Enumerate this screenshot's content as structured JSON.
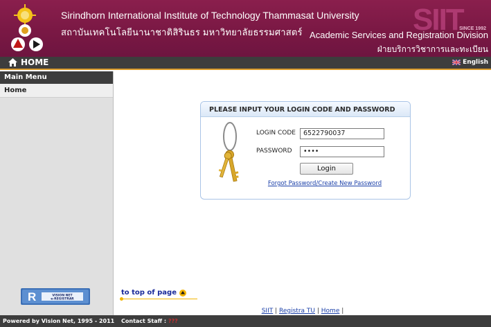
{
  "header": {
    "institute_en": "Sirindhorn International Institute of Technology Thammasat University",
    "institute_th": "สถาบันเทคโนโลยีนานาชาติสิรินธร มหาวิทยาลัยธรรมศาสตร์",
    "siit_mark": "SIIT",
    "since": "SINCE 1992",
    "division_en": "Academic Services and Registration Division",
    "division_th": "ฝ่ายบริการวิชาการและทะเบียน"
  },
  "nav": {
    "home_label": "HOME",
    "language_label": "English",
    "language_icon": "uk-flag-icon"
  },
  "sidebar": {
    "heading": "Main Menu",
    "items": [
      {
        "label": "Home"
      }
    ],
    "logo_text": "VISION NET e-REGISTRAR"
  },
  "login": {
    "title": "PLEASE INPUT YOUR LOGIN CODE AND PASSWORD",
    "login_code_label": "LOGIN CODE",
    "login_code_value": "6522790037",
    "password_label": "PASSWORD",
    "password_value": "••••",
    "button_label": "Login",
    "forgot_link": "Forgot Password/Create New Password"
  },
  "main": {
    "top_link": "to top of page",
    "bottom_links": [
      "SIIT",
      "Registra TU",
      "Home"
    ]
  },
  "footer": {
    "powered": "Powered by Vision Net, 1995 - 2011",
    "contact_label": "Contact Staff :",
    "contact_value": "???"
  },
  "colors": {
    "banner": "#7a1844",
    "navbar": "#3d3d3d",
    "accent": "#d99a2a",
    "link": "#1a3fa8"
  }
}
